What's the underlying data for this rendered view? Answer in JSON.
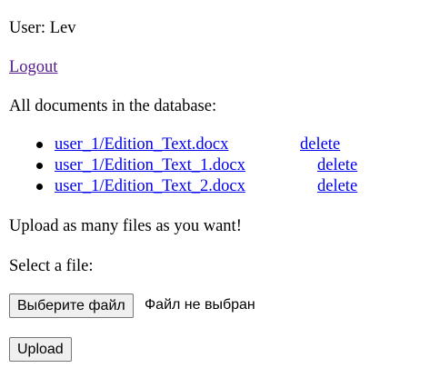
{
  "user": {
    "label": "User: Lev"
  },
  "logout": {
    "label": "Logout"
  },
  "documents": {
    "heading": "All documents in the database:",
    "items": [
      {
        "name": "user_1/Edition_Text.docx",
        "delete_label": "delete"
      },
      {
        "name": "user_1/Edition_Text_1.docx",
        "delete_label": "delete"
      },
      {
        "name": "user_1/Edition_Text_2.docx",
        "delete_label": "delete"
      }
    ]
  },
  "upload": {
    "heading": "Upload as many files as you want!",
    "select_label": "Select a file:",
    "choose_button_label": "Выберите файл",
    "no_file_text": "Файл не выбран",
    "submit_label": "Upload"
  },
  "colors": {
    "link": "#0000ee",
    "visited_link": "#551a8b",
    "button_bg": "#efefef",
    "button_border": "#767676"
  }
}
